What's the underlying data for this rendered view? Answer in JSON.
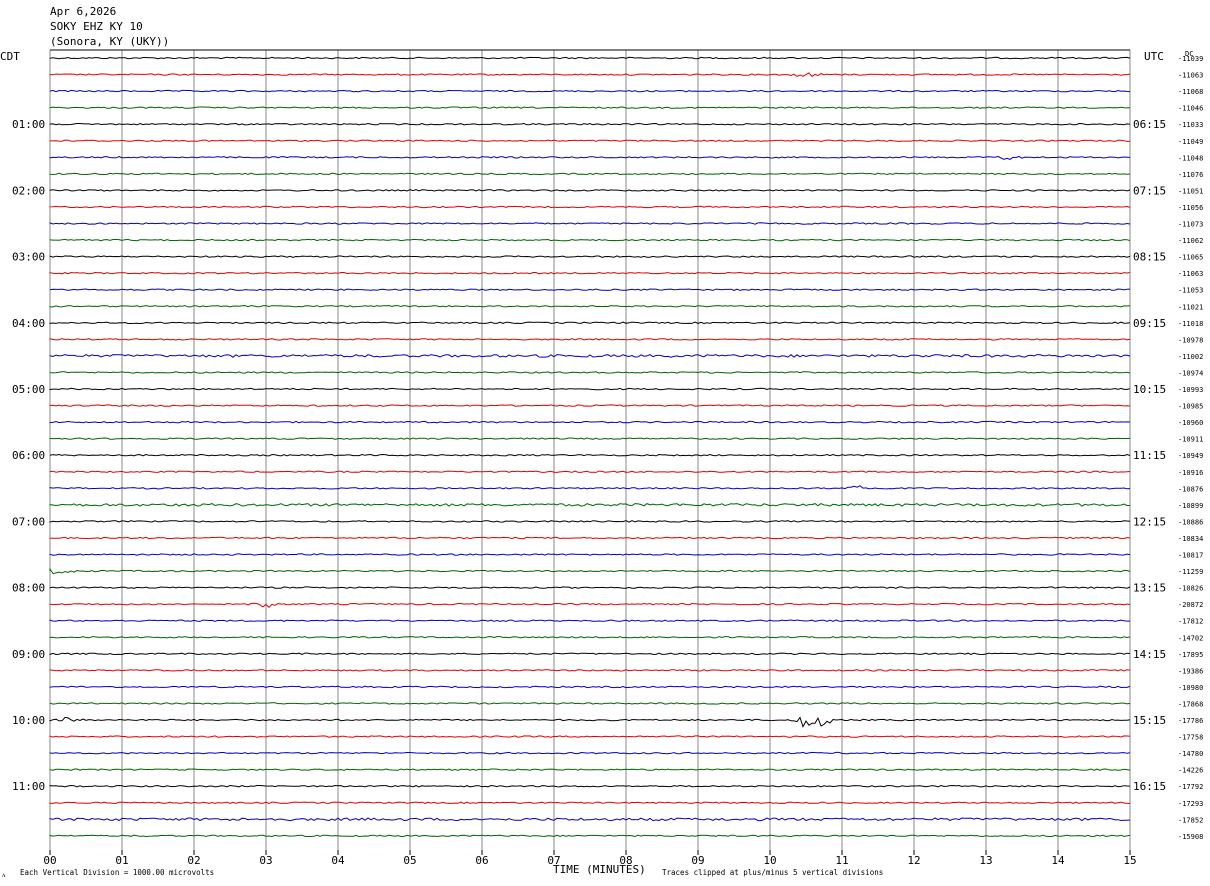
{
  "header": {
    "line1": "Apr 6,2026",
    "line2": "SOKY EHZ KY 10",
    "line3": "(Sonora, KY (UKY))"
  },
  "left_axis_label": "CDT",
  "right_axis_label": "UTC",
  "dc_label": "DC",
  "footer": {
    "xlabel": "TIME (MINUTES)",
    "scale_note": "Each Vertical Division = 1000.00 microvolts",
    "clip_note": "Traces clipped at plus/minus 5 vertical divisions"
  },
  "chart_data": {
    "type": "line",
    "title": "SOKY EHZ KY 10",
    "xlabel": "TIME (MINUTES)",
    "xlim": [
      0,
      15
    ],
    "x_ticks": [
      "00",
      "01",
      "02",
      "03",
      "04",
      "05",
      "06",
      "07",
      "08",
      "09",
      "10",
      "11",
      "12",
      "13",
      "14",
      "15"
    ],
    "trace_colors": [
      "#000000",
      "#e00000",
      "#0000c0",
      "#006400"
    ],
    "grid": true,
    "left_time_labels": [
      "01:00",
      "02:00",
      "03:00",
      "04:00",
      "05:00",
      "06:00",
      "07:00",
      "08:00",
      "09:00",
      "10:00",
      "11:00"
    ],
    "right_time_labels": [
      "06:15",
      "07:15",
      "08:15",
      "09:15",
      "10:15",
      "11:15",
      "12:15",
      "13:15",
      "14:15",
      "15:15",
      "16:15"
    ],
    "dc_offsets": [
      "-11039",
      "-11063",
      "-11068",
      "-11046",
      "-11033",
      "-11049",
      "-11048",
      "-11076",
      "-11051",
      "-11056",
      "-11073",
      "-11062",
      "-11065",
      "-11063",
      "-11053",
      "-11021",
      "-11018",
      "-10978",
      "-11002",
      "-10974",
      "-10993",
      "-10985",
      "-10960",
      "-10911",
      "-10949",
      "-10916",
      "-10876",
      "-10899",
      "-10886",
      "-10834",
      "-10817",
      "-11259",
      "-10826",
      "-20872",
      "-17812",
      "-14702",
      "-17895",
      "-19386",
      "-10980",
      "-17868",
      "-17786",
      "-17758",
      "-14780",
      "-14226",
      "-17792",
      "-17293",
      "-17852",
      "-15908"
    ],
    "events": [
      {
        "trace": 40,
        "minute": 10.6,
        "amplitude": 5
      },
      {
        "trace": 40,
        "minute": 0.2,
        "amplitude": 1.2
      },
      {
        "trace": 26,
        "minute": 11.3,
        "amplitude": 2
      },
      {
        "trace": 31,
        "minute": 0.1,
        "amplitude": 1.5
      },
      {
        "trace": 33,
        "minute": 3.0,
        "amplitude": 1.5
      },
      {
        "trace": 1,
        "minute": 10.5,
        "amplitude": 1.2
      },
      {
        "trace": 6,
        "minute": 13.3,
        "amplitude": 1.0
      }
    ]
  }
}
